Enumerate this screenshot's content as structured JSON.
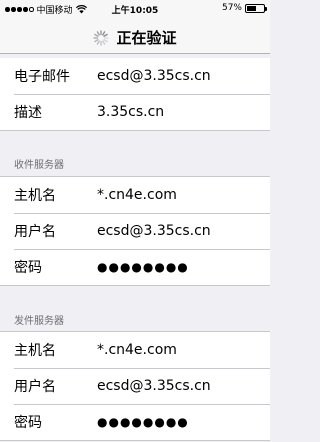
{
  "status_bar": {
    "carrier": "中国移动",
    "time": "上午10:05",
    "battery_percent": "57%",
    "battery_level": 0.57,
    "signal_bars_filled": 4
  },
  "nav": {
    "title": "正在验证"
  },
  "account_section": {
    "rows": [
      {
        "label": "电子邮件",
        "value": "ecsd@3.35cs.cn"
      },
      {
        "label": "描述",
        "value": "3.35cs.cn"
      }
    ]
  },
  "incoming_section": {
    "header": "收件服务器",
    "rows": [
      {
        "label": "主机名",
        "value": "*.cn4e.com"
      },
      {
        "label": "用户名",
        "value": "ecsd@3.35cs.cn"
      },
      {
        "label": "密码",
        "value": "●●●●●●●●"
      }
    ]
  },
  "outgoing_section": {
    "header": "发件服务器",
    "rows": [
      {
        "label": "主机名",
        "value": "*.cn4e.com"
      },
      {
        "label": "用户名",
        "value": "ecsd@3.35cs.cn"
      },
      {
        "label": "密码",
        "value": "●●●●●●●●"
      }
    ]
  }
}
